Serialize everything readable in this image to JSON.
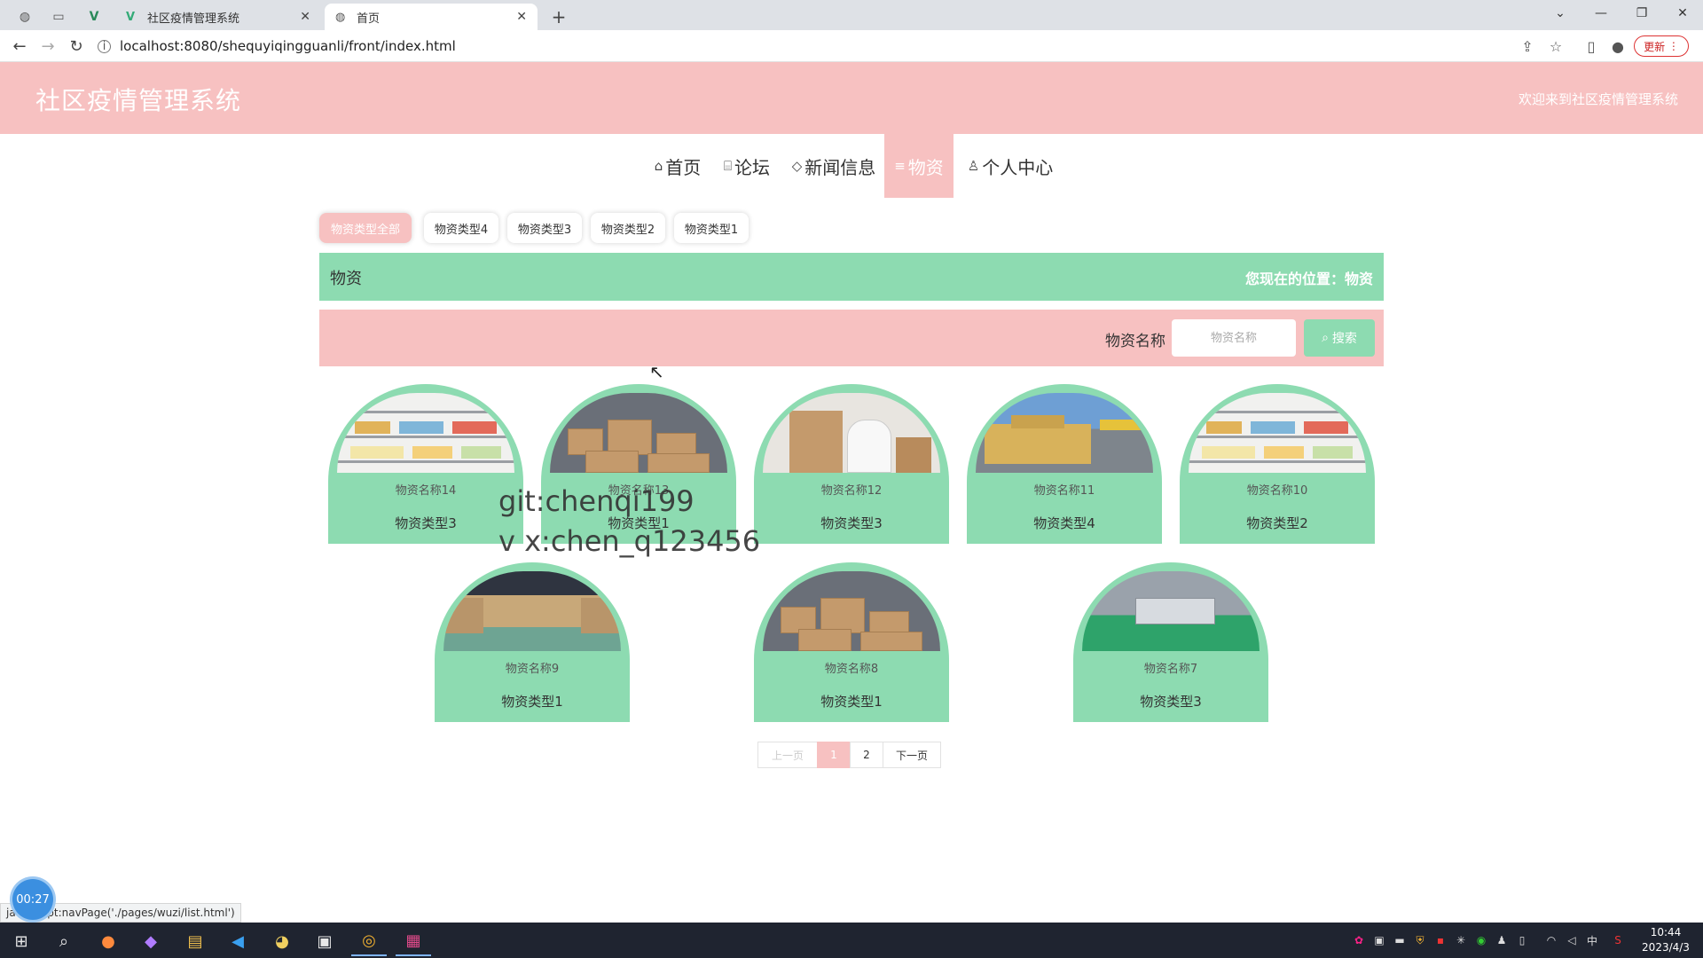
{
  "browser": {
    "tabs": [
      {
        "title": "社区疫情管理系统",
        "active": false
      },
      {
        "title": "首页",
        "active": true
      }
    ],
    "url": "localhost:8080/shequyiqingguanli/front/index.html",
    "update_label": "更新",
    "status_text": "javascript:navPage('./pages/wuzi/list.html')"
  },
  "header": {
    "title": "社区疫情管理系统",
    "welcome": "欢迎来到社区疫情管理系统"
  },
  "nav": {
    "items": [
      {
        "icon": "home-icon",
        "glyph": "⌂",
        "label": "首页"
      },
      {
        "icon": "book-icon",
        "glyph": "⌸",
        "label": "论坛"
      },
      {
        "icon": "tag-icon",
        "glyph": "◇",
        "label": "新闻信息"
      },
      {
        "icon": "list-icon",
        "glyph": "≡",
        "label": "物资"
      },
      {
        "icon": "user-icon",
        "glyph": "♙",
        "label": "个人中心"
      }
    ],
    "active_index": 3
  },
  "filters": [
    "物资类型全部",
    "物资类型4",
    "物资类型3",
    "物资类型2",
    "物资类型1"
  ],
  "breadcrumb": {
    "title": "物资",
    "location": "您现在的位置：物资"
  },
  "search": {
    "label": "物资名称",
    "placeholder": "物资名称",
    "button": "搜索"
  },
  "items": [
    {
      "name": "物资名称14",
      "type": "物资类型3",
      "image": "shelf"
    },
    {
      "name": "物资名称13",
      "type": "物资类型1",
      "image": "cartons"
    },
    {
      "name": "物资名称12",
      "type": "物资类型3",
      "image": "worker"
    },
    {
      "name": "物资名称11",
      "type": "物资类型4",
      "image": "truck"
    },
    {
      "name": "物资名称10",
      "type": "物资类型2",
      "image": "shelf"
    },
    {
      "name": "物资名称9",
      "type": "物资类型1",
      "image": "hall"
    },
    {
      "name": "物资名称8",
      "type": "物资类型1",
      "image": "cartons"
    },
    {
      "name": "物资名称7",
      "type": "物资类型3",
      "image": "plant"
    }
  ],
  "pagination": {
    "prev": "上一页",
    "pages": [
      "1",
      "2"
    ],
    "current": "1",
    "next": "下一页"
  },
  "watermark": {
    "line1": "git:chenqi199",
    "line2": "v x:chen_q123456"
  },
  "recorder": {
    "timer": "00:27"
  },
  "taskbar": {
    "time": "10:44",
    "date": "2023/4/3",
    "ime": "中"
  },
  "colors": {
    "header_pink": "#f7c1c1",
    "accent_green": "#8ddbb1"
  }
}
